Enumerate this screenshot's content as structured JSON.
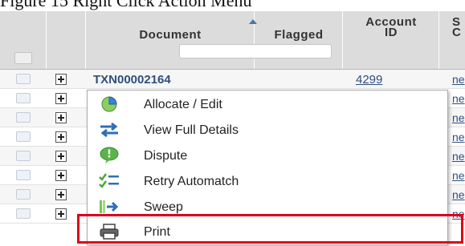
{
  "page_title": "Figure 15 Right Click Action Menu",
  "grid": {
    "columns": {
      "document": "Document",
      "flagged": "Flagged",
      "account_id_line1": "Account",
      "account_id_line2": "ID",
      "next_col_line1": "S",
      "next_col_line2": "C"
    },
    "rows": [
      {
        "document": "TXN00002164",
        "account_id": "4299",
        "next": "ne"
      },
      {
        "document": "",
        "account_id": "",
        "next": "ne"
      },
      {
        "document": "",
        "account_id": "",
        "next": "ne"
      },
      {
        "document": "",
        "account_id": "",
        "next": "ne"
      },
      {
        "document": "",
        "account_id": "",
        "next": "ne"
      },
      {
        "document": "",
        "account_id": "",
        "next": "ne"
      },
      {
        "document": "",
        "account_id": "",
        "next": "ne"
      },
      {
        "document": "",
        "account_id": "",
        "next": "ne"
      }
    ]
  },
  "context_menu": {
    "items": [
      {
        "label": "Allocate / Edit",
        "icon": "pie-chart-icon"
      },
      {
        "label": "View Full Details",
        "icon": "swap-arrows-icon"
      },
      {
        "label": "Dispute",
        "icon": "speech-bubble-icon"
      },
      {
        "label": "Retry Automatch",
        "icon": "checklist-icon"
      },
      {
        "label": "Sweep",
        "icon": "sweep-arrow-icon"
      },
      {
        "label": "Print",
        "icon": "printer-icon"
      }
    ],
    "highlighted_item": "Print",
    "highlight_color": "#e0001b"
  }
}
